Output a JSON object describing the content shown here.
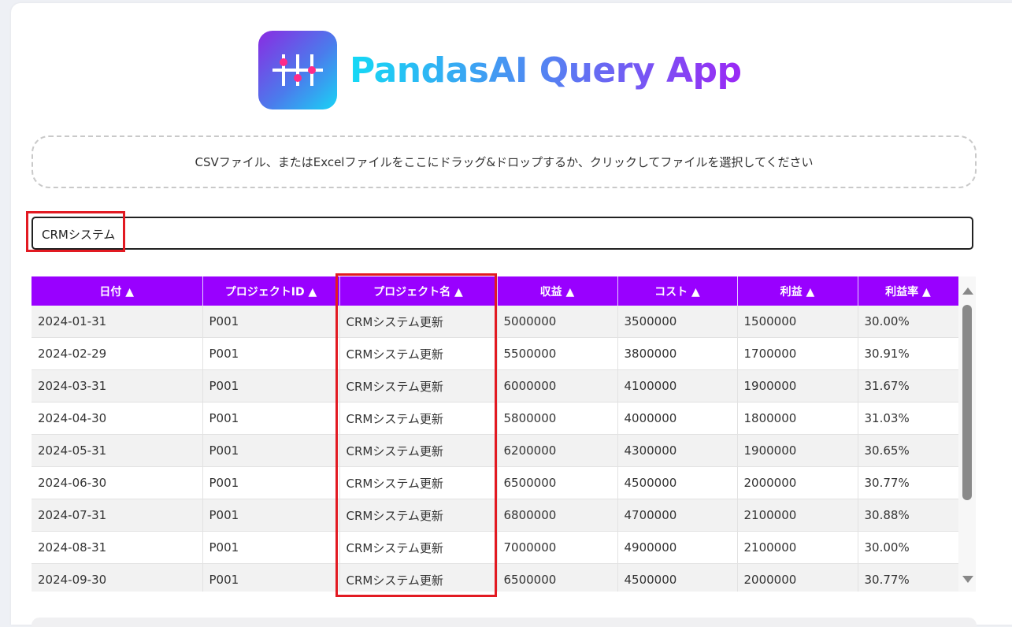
{
  "app": {
    "title": "PandasAI Query App",
    "logo_icon": "sliders-icon"
  },
  "dropzone": {
    "text": "CSVファイル、またはExcelファイルをここにドラッグ&ドロップするか、クリックしてファイルを選択してください"
  },
  "search": {
    "value": "CRMシステム"
  },
  "table": {
    "headers": [
      "日付 ▲",
      "プロジェクトID ▲",
      "プロジェクト名 ▲",
      "収益 ▲",
      "コスト ▲",
      "利益 ▲",
      "利益率 ▲"
    ],
    "rows": [
      [
        "2024-01-31",
        "P001",
        "CRMシステム更新",
        "5000000",
        "3500000",
        "1500000",
        "30.00%"
      ],
      [
        "2024-02-29",
        "P001",
        "CRMシステム更新",
        "5500000",
        "3800000",
        "1700000",
        "30.91%"
      ],
      [
        "2024-03-31",
        "P001",
        "CRMシステム更新",
        "6000000",
        "4100000",
        "1900000",
        "31.67%"
      ],
      [
        "2024-04-30",
        "P001",
        "CRMシステム更新",
        "5800000",
        "4000000",
        "1800000",
        "31.03%"
      ],
      [
        "2024-05-31",
        "P001",
        "CRMシステム更新",
        "6200000",
        "4300000",
        "1900000",
        "30.65%"
      ],
      [
        "2024-06-30",
        "P001",
        "CRMシステム更新",
        "6500000",
        "4500000",
        "2000000",
        "30.77%"
      ],
      [
        "2024-07-31",
        "P001",
        "CRMシステム更新",
        "6800000",
        "4700000",
        "2100000",
        "30.88%"
      ],
      [
        "2024-08-31",
        "P001",
        "CRMシステム更新",
        "7000000",
        "4900000",
        "2100000",
        "30.00%"
      ],
      [
        "2024-09-30",
        "P001",
        "CRMシステム更新",
        "6500000",
        "4500000",
        "2000000",
        "30.77%"
      ]
    ]
  },
  "colors": {
    "header_bg": "#9900ff",
    "highlight": "#e21a22"
  }
}
